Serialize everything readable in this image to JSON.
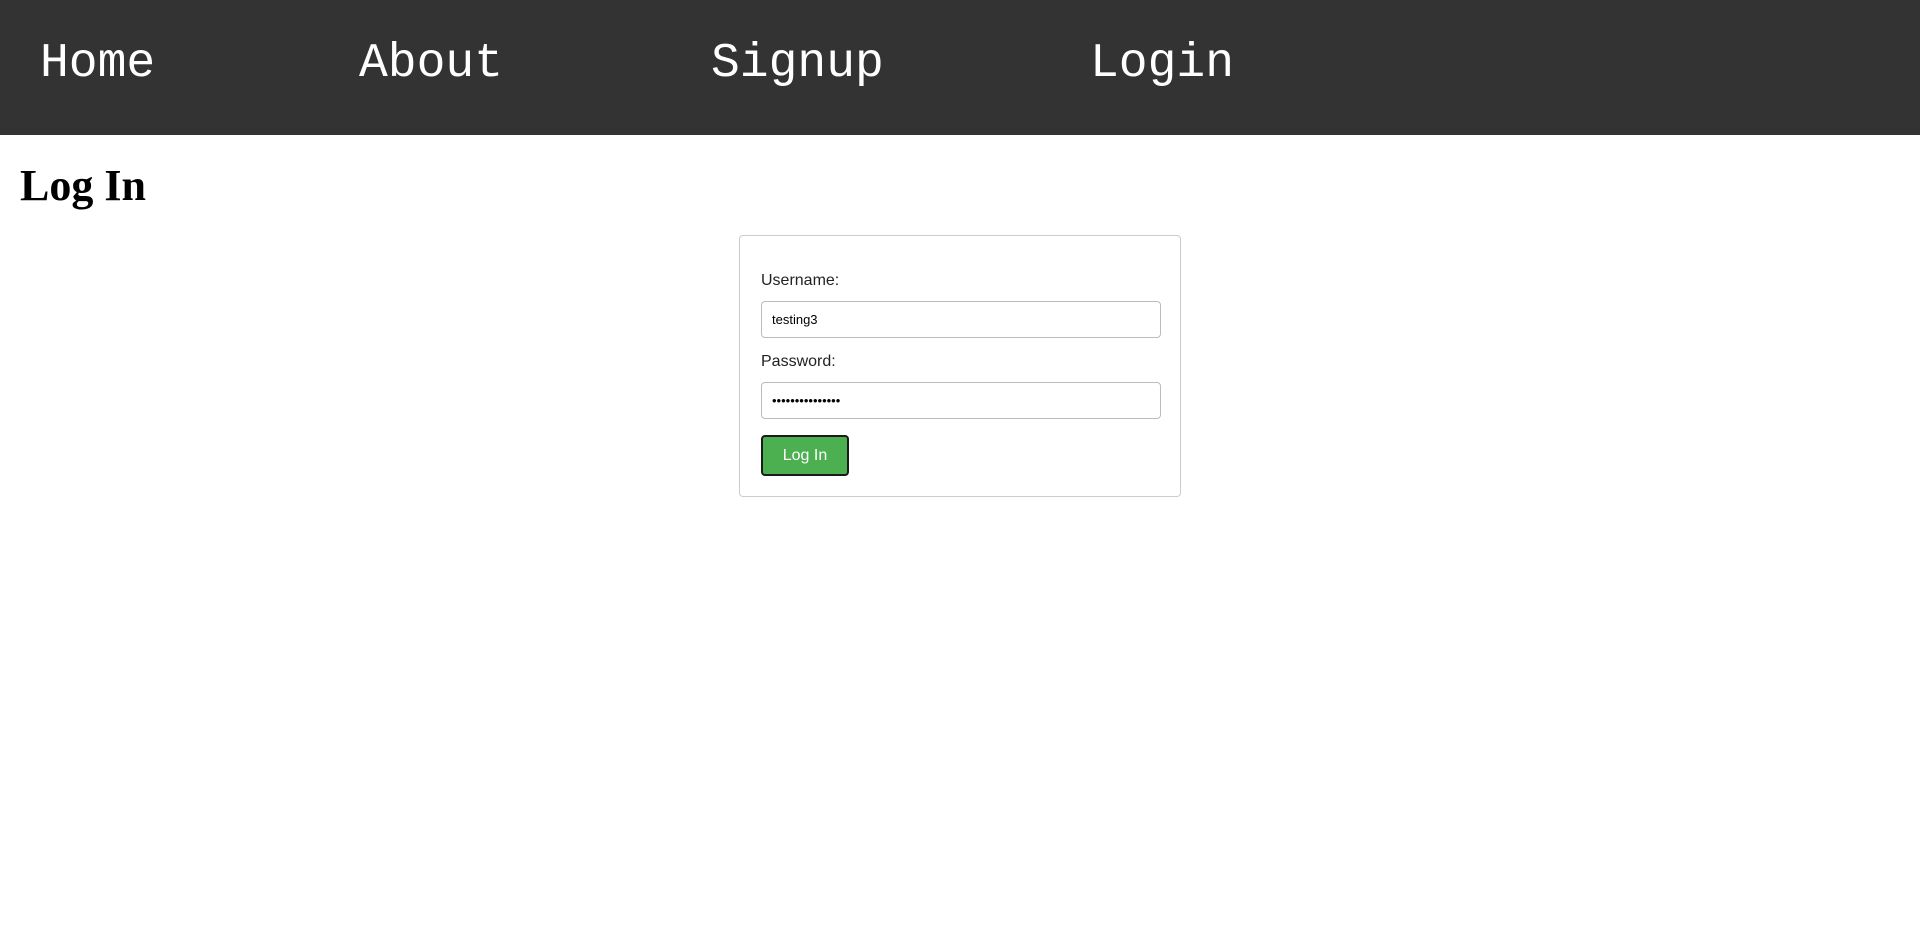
{
  "nav": {
    "home": "Home",
    "about": "About",
    "signup": "Signup",
    "login": "Login"
  },
  "page": {
    "title": "Log In"
  },
  "form": {
    "username_label": "Username:",
    "username_value": "testing3",
    "password_label": "Password:",
    "password_value": "•••••••••••••••",
    "submit_label": "Log In"
  },
  "colors": {
    "nav_background": "#333333",
    "nav_text": "#ffffff",
    "button_background": "#4caf50",
    "button_text": "#ffffff",
    "box_border": "#cccccc"
  }
}
